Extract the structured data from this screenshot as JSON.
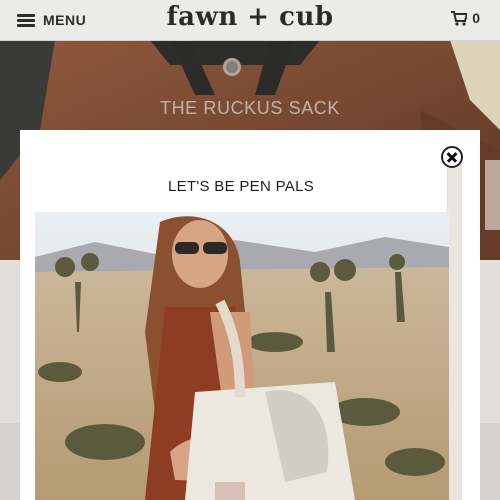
{
  "header": {
    "menu_label": "MENU",
    "logo_text": "fawn + cub",
    "cart_count": "0"
  },
  "hero": {
    "title": "THE RUCKUS SACK"
  },
  "modal": {
    "title": "LET'S BE PEN PALS"
  },
  "icons": {
    "menu": "hamburger-icon",
    "cart": "shopping-cart-icon",
    "close": "close-icon"
  },
  "colors": {
    "hero_brown": "#7f4c34",
    "dark_text": "#2b2b2b",
    "hero_text": "#cfc0b4"
  }
}
